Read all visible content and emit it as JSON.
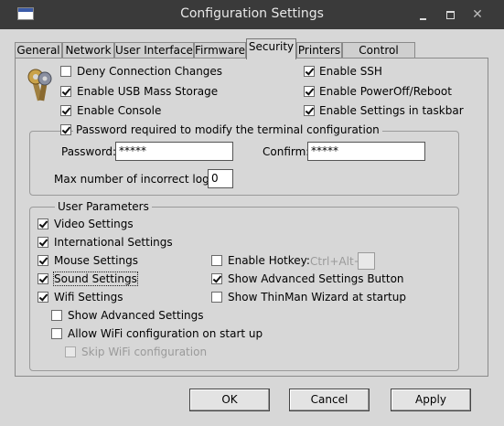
{
  "window": {
    "title": "Configuration Settings"
  },
  "tabs": [
    "General",
    "Network",
    "User Interface",
    "Firmware",
    "Security",
    "Printers",
    "Control Panel"
  ],
  "active_tab": "Security",
  "security": {
    "deny_connection_changes": "Deny Connection Changes",
    "enable_usb_mass_storage": "Enable USB Mass Storage",
    "enable_console": "Enable Console",
    "enable_ssh": "Enable SSH",
    "enable_poweroff_reboot": "Enable PowerOff/Reboot",
    "enable_settings_taskbar": "Enable Settings in taskbar",
    "password_required": "Password required to modify the terminal configuration",
    "password_label": "Password:",
    "password_value": "*****",
    "confirm_label": "Confirm:",
    "confirm_value": "*****",
    "max_login_label": "Max number of incorrect login:",
    "max_login_value": "0"
  },
  "user_parameters": {
    "legend": "User Parameters",
    "video_settings": "Video Settings",
    "international_settings": "International Settings",
    "mouse_settings": "Mouse Settings",
    "sound_settings": "Sound Settings",
    "wifi_settings": "Wifi Settings",
    "show_advanced_settings": "Show Advanced Settings",
    "allow_wifi_config": "Allow WiFi configuration on start up",
    "skip_wifi_config": "Skip WiFi configuration",
    "enable_hotkey": "Enable Hotkey:",
    "hotkey_combo": "Ctrl+Alt+",
    "show_advanced_button": "Show Advanced Settings Button",
    "show_thinman_wizard": "Show ThinMan Wizard at startup"
  },
  "buttons": {
    "ok": "OK",
    "cancel": "Cancel",
    "apply": "Apply"
  },
  "icons": [
    "app-icon",
    "keys-icon",
    "minimize-icon",
    "maximize-icon",
    "close-icon"
  ]
}
